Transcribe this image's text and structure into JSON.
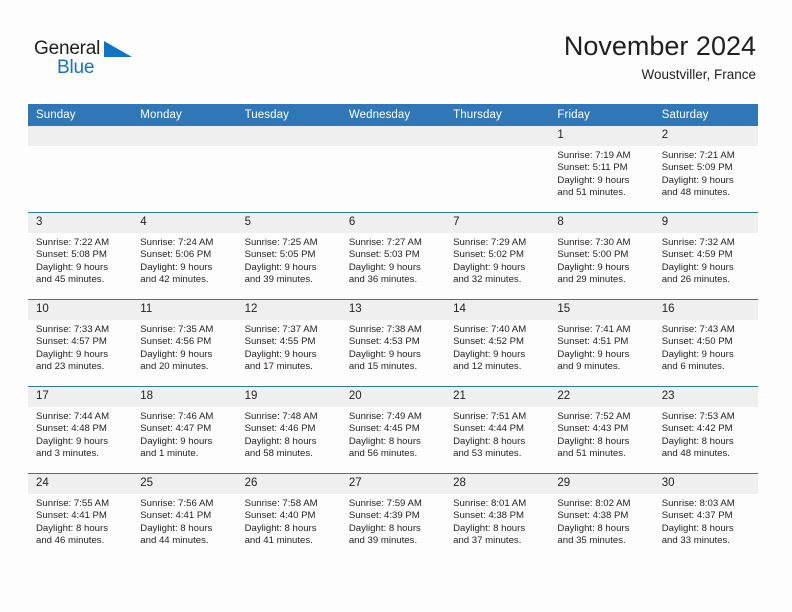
{
  "brand": {
    "name_part1": "General",
    "name_part2": "Blue",
    "accent_color": "#1273c4",
    "logo_icon": "blue-triangle-flag-icon"
  },
  "header": {
    "month_title": "November 2024",
    "location": "Woustviller, France",
    "header_bg_color": "#3077b8",
    "daynum_bg_color": "#efefef"
  },
  "weekdays": [
    "Sunday",
    "Monday",
    "Tuesday",
    "Wednesday",
    "Thursday",
    "Friday",
    "Saturday"
  ],
  "weeks": [
    [
      {
        "day": "",
        "empty": true
      },
      {
        "day": "",
        "empty": true
      },
      {
        "day": "",
        "empty": true
      },
      {
        "day": "",
        "empty": true
      },
      {
        "day": "",
        "empty": true
      },
      {
        "day": "1",
        "sunrise": "Sunrise: 7:19 AM",
        "sunset": "Sunset: 5:11 PM",
        "daylight_line1": "Daylight: 9 hours",
        "daylight_line2": "and 51 minutes."
      },
      {
        "day": "2",
        "sunrise": "Sunrise: 7:21 AM",
        "sunset": "Sunset: 5:09 PM",
        "daylight_line1": "Daylight: 9 hours",
        "daylight_line2": "and 48 minutes."
      }
    ],
    [
      {
        "day": "3",
        "sunrise": "Sunrise: 7:22 AM",
        "sunset": "Sunset: 5:08 PM",
        "daylight_line1": "Daylight: 9 hours",
        "daylight_line2": "and 45 minutes."
      },
      {
        "day": "4",
        "sunrise": "Sunrise: 7:24 AM",
        "sunset": "Sunset: 5:06 PM",
        "daylight_line1": "Daylight: 9 hours",
        "daylight_line2": "and 42 minutes."
      },
      {
        "day": "5",
        "sunrise": "Sunrise: 7:25 AM",
        "sunset": "Sunset: 5:05 PM",
        "daylight_line1": "Daylight: 9 hours",
        "daylight_line2": "and 39 minutes."
      },
      {
        "day": "6",
        "sunrise": "Sunrise: 7:27 AM",
        "sunset": "Sunset: 5:03 PM",
        "daylight_line1": "Daylight: 9 hours",
        "daylight_line2": "and 36 minutes."
      },
      {
        "day": "7",
        "sunrise": "Sunrise: 7:29 AM",
        "sunset": "Sunset: 5:02 PM",
        "daylight_line1": "Daylight: 9 hours",
        "daylight_line2": "and 32 minutes."
      },
      {
        "day": "8",
        "sunrise": "Sunrise: 7:30 AM",
        "sunset": "Sunset: 5:00 PM",
        "daylight_line1": "Daylight: 9 hours",
        "daylight_line2": "and 29 minutes."
      },
      {
        "day": "9",
        "sunrise": "Sunrise: 7:32 AM",
        "sunset": "Sunset: 4:59 PM",
        "daylight_line1": "Daylight: 9 hours",
        "daylight_line2": "and 26 minutes."
      }
    ],
    [
      {
        "day": "10",
        "sunrise": "Sunrise: 7:33 AM",
        "sunset": "Sunset: 4:57 PM",
        "daylight_line1": "Daylight: 9 hours",
        "daylight_line2": "and 23 minutes."
      },
      {
        "day": "11",
        "sunrise": "Sunrise: 7:35 AM",
        "sunset": "Sunset: 4:56 PM",
        "daylight_line1": "Daylight: 9 hours",
        "daylight_line2": "and 20 minutes."
      },
      {
        "day": "12",
        "sunrise": "Sunrise: 7:37 AM",
        "sunset": "Sunset: 4:55 PM",
        "daylight_line1": "Daylight: 9 hours",
        "daylight_line2": "and 17 minutes."
      },
      {
        "day": "13",
        "sunrise": "Sunrise: 7:38 AM",
        "sunset": "Sunset: 4:53 PM",
        "daylight_line1": "Daylight: 9 hours",
        "daylight_line2": "and 15 minutes."
      },
      {
        "day": "14",
        "sunrise": "Sunrise: 7:40 AM",
        "sunset": "Sunset: 4:52 PM",
        "daylight_line1": "Daylight: 9 hours",
        "daylight_line2": "and 12 minutes."
      },
      {
        "day": "15",
        "sunrise": "Sunrise: 7:41 AM",
        "sunset": "Sunset: 4:51 PM",
        "daylight_line1": "Daylight: 9 hours",
        "daylight_line2": "and 9 minutes."
      },
      {
        "day": "16",
        "sunrise": "Sunrise: 7:43 AM",
        "sunset": "Sunset: 4:50 PM",
        "daylight_line1": "Daylight: 9 hours",
        "daylight_line2": "and 6 minutes."
      }
    ],
    [
      {
        "day": "17",
        "sunrise": "Sunrise: 7:44 AM",
        "sunset": "Sunset: 4:48 PM",
        "daylight_line1": "Daylight: 9 hours",
        "daylight_line2": "and 3 minutes."
      },
      {
        "day": "18",
        "sunrise": "Sunrise: 7:46 AM",
        "sunset": "Sunset: 4:47 PM",
        "daylight_line1": "Daylight: 9 hours",
        "daylight_line2": "and 1 minute."
      },
      {
        "day": "19",
        "sunrise": "Sunrise: 7:48 AM",
        "sunset": "Sunset: 4:46 PM",
        "daylight_line1": "Daylight: 8 hours",
        "daylight_line2": "and 58 minutes."
      },
      {
        "day": "20",
        "sunrise": "Sunrise: 7:49 AM",
        "sunset": "Sunset: 4:45 PM",
        "daylight_line1": "Daylight: 8 hours",
        "daylight_line2": "and 56 minutes."
      },
      {
        "day": "21",
        "sunrise": "Sunrise: 7:51 AM",
        "sunset": "Sunset: 4:44 PM",
        "daylight_line1": "Daylight: 8 hours",
        "daylight_line2": "and 53 minutes."
      },
      {
        "day": "22",
        "sunrise": "Sunrise: 7:52 AM",
        "sunset": "Sunset: 4:43 PM",
        "daylight_line1": "Daylight: 8 hours",
        "daylight_line2": "and 51 minutes."
      },
      {
        "day": "23",
        "sunrise": "Sunrise: 7:53 AM",
        "sunset": "Sunset: 4:42 PM",
        "daylight_line1": "Daylight: 8 hours",
        "daylight_line2": "and 48 minutes."
      }
    ],
    [
      {
        "day": "24",
        "sunrise": "Sunrise: 7:55 AM",
        "sunset": "Sunset: 4:41 PM",
        "daylight_line1": "Daylight: 8 hours",
        "daylight_line2": "and 46 minutes."
      },
      {
        "day": "25",
        "sunrise": "Sunrise: 7:56 AM",
        "sunset": "Sunset: 4:41 PM",
        "daylight_line1": "Daylight: 8 hours",
        "daylight_line2": "and 44 minutes."
      },
      {
        "day": "26",
        "sunrise": "Sunrise: 7:58 AM",
        "sunset": "Sunset: 4:40 PM",
        "daylight_line1": "Daylight: 8 hours",
        "daylight_line2": "and 41 minutes."
      },
      {
        "day": "27",
        "sunrise": "Sunrise: 7:59 AM",
        "sunset": "Sunset: 4:39 PM",
        "daylight_line1": "Daylight: 8 hours",
        "daylight_line2": "and 39 minutes."
      },
      {
        "day": "28",
        "sunrise": "Sunrise: 8:01 AM",
        "sunset": "Sunset: 4:38 PM",
        "daylight_line1": "Daylight: 8 hours",
        "daylight_line2": "and 37 minutes."
      },
      {
        "day": "29",
        "sunrise": "Sunrise: 8:02 AM",
        "sunset": "Sunset: 4:38 PM",
        "daylight_line1": "Daylight: 8 hours",
        "daylight_line2": "and 35 minutes."
      },
      {
        "day": "30",
        "sunrise": "Sunrise: 8:03 AM",
        "sunset": "Sunset: 4:37 PM",
        "daylight_line1": "Daylight: 8 hours",
        "daylight_line2": "and 33 minutes."
      }
    ]
  ]
}
